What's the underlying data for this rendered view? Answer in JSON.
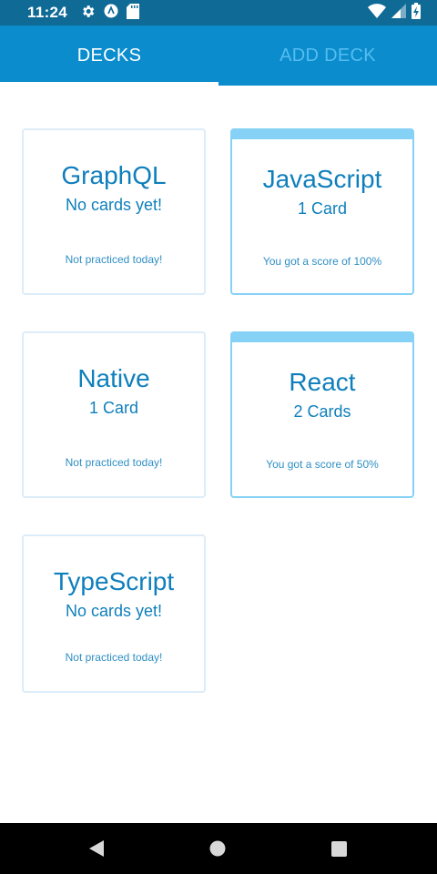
{
  "status_bar": {
    "time": "11:24",
    "left_icons": [
      "gear-icon",
      "app-a-icon",
      "sd-card-icon"
    ],
    "right_icons": [
      "wifi-icon",
      "signal-icon",
      "battery-charging-icon"
    ]
  },
  "tabs": [
    {
      "label": "DECKS",
      "active": true
    },
    {
      "label": "ADD DECK",
      "active": false
    }
  ],
  "decks": [
    {
      "title": "GraphQL",
      "count": "No cards yet!",
      "status": "Not practiced today!",
      "practiced": false
    },
    {
      "title": "JavaScript",
      "count": "1 Card",
      "status": "You got a score of 100%",
      "practiced": true
    },
    {
      "title": "Native",
      "count": "1 Card",
      "status": "Not practiced today!",
      "practiced": false
    },
    {
      "title": "React",
      "count": "2 Cards",
      "status": "You got a score of 50%",
      "practiced": true
    },
    {
      "title": "TypeScript",
      "count": "No cards yet!",
      "status": "Not practiced today!",
      "practiced": false
    }
  ],
  "nav_bar": [
    "back-icon",
    "home-icon",
    "recents-icon"
  ],
  "colors": {
    "status_bar": "#0f6a96",
    "tab_bar": "#0a8ccd",
    "inactive_tab_text": "#55bdf0",
    "deck_text": "#0f7fbc",
    "practiced_accent": "#86d2f6",
    "card_border": "#dcecf8"
  }
}
